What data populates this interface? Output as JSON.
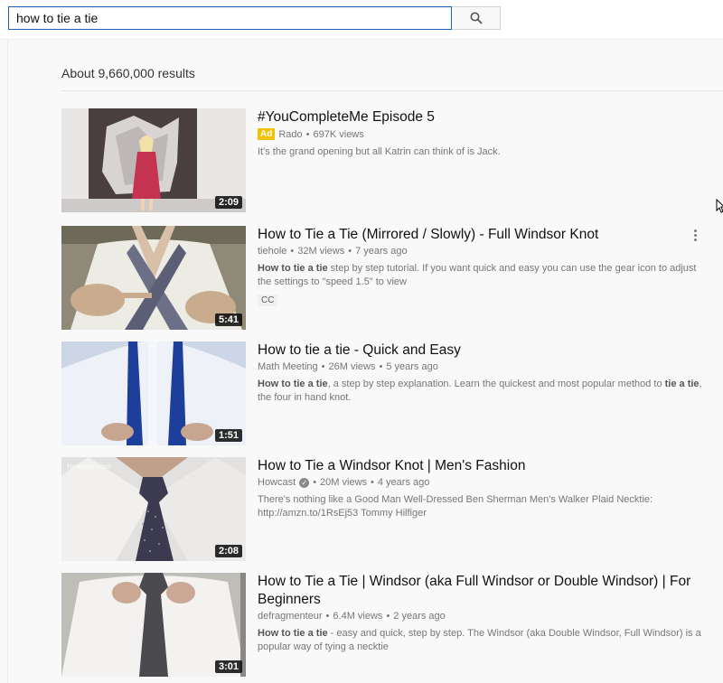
{
  "search": {
    "query": "how to tie a tie",
    "button_icon": "search-icon"
  },
  "results_summary": "About 9,660,000 results",
  "results": [
    {
      "title": "#YouCompleteMe Episode 5",
      "ad_label": "Ad",
      "channel": "Rado",
      "views": "697K views",
      "age": "",
      "description": "It's the grand opening but all Katrin can think of is Jack.",
      "duration": "2:09",
      "cc": ""
    },
    {
      "title": "How to Tie a Tie (Mirrored / Slowly) - Full Windsor Knot",
      "channel": "tiehole",
      "views": "32M views",
      "age": "7 years ago",
      "desc_bold": "How to tie a tie",
      "desc_rest": " step by step tutorial. If you want quick and easy you can use the gear icon to adjust the settings to \"speed 1.5\" to view",
      "duration": "5:41",
      "cc": "CC",
      "menu_icon": "more-vert-icon"
    },
    {
      "title": "How to tie a tie - Quick and Easy",
      "channel": "Math Meeting",
      "views": "26M views",
      "age": "5 years ago",
      "desc_bold1": "How to tie a tie",
      "desc_mid": ", a step by step explanation. Learn the quickest and most popular method to ",
      "desc_bold2": "tie a tie",
      "desc_end": ", the four in hand knot.",
      "duration": "1:51"
    },
    {
      "title": "How to Tie a Windsor Knot | Men's Fashion",
      "channel": "Howcast",
      "verified_icon": "verified-check-icon",
      "views": "20M views",
      "age": "4 years ago",
      "description": "There's nothing like a Good Man Well-Dressed Ben Sherman Men's Walker Plaid Necktie: http://amzn.to/1RsEj53 Tommy Hilfiger",
      "duration": "2:08",
      "watermark": "Howcast.com"
    },
    {
      "title": "How to Tie a Tie | Windsor (aka Full Windsor or Double Windsor) | For Beginners",
      "channel": "defragmenteur",
      "views": "6.4M views",
      "age": "2 years ago",
      "desc_bold": "How to tie a tie",
      "desc_rest": " - easy and quick, step by step. The Windsor (aka Double Windsor, Full Windsor) is a popular way of tying a necktie",
      "duration": "3:01"
    }
  ],
  "separator": "•",
  "colors": {
    "search_border": "#1c62b9",
    "ad_badge": "#f2c200",
    "meta_text": "#767676"
  }
}
